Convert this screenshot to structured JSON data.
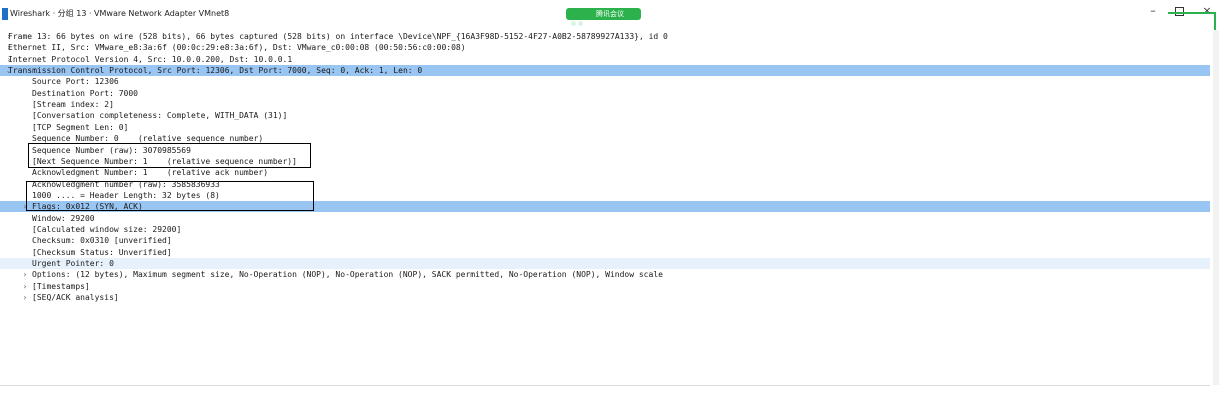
{
  "window": {
    "title": "Wireshark · 分组 13 · VMware Network Adapter VMnet8",
    "minimize": "–",
    "close": "×",
    "meeting_label": "腾讯会议"
  },
  "colors": {
    "selected": "#99c5f2",
    "hover": "#e7f1fb",
    "accent": "#2bb24c"
  },
  "tree": [
    {
      "caret": "›",
      "text": "Frame 13: 66 bytes on wire (528 bits), 66 bytes captured (528 bits) on interface \\Device\\NPF_{16A3F98D-5152-4F27-A0B2-58789927A133}, id 0"
    },
    {
      "caret": "›",
      "text": "Ethernet II, Src: VMware_e8:3a:6f (00:0c:29:e8:3a:6f), Dst: VMware_c0:00:08 (00:50:56:c0:00:08)"
    },
    {
      "caret": "›",
      "text": "Internet Protocol Version 4, Src: 10.0.0.200, Dst: 10.0.0.1"
    },
    {
      "caret": "⌄",
      "text": "Transmission Control Protocol, Src Port: 12306, Dst Port: 7000, Seq: 0, Ack: 1, Len: 0"
    },
    {
      "caret": "",
      "text": "Source Port: 12306"
    },
    {
      "caret": "",
      "text": "Destination Port: 7000"
    },
    {
      "caret": "",
      "text": "[Stream index: 2]"
    },
    {
      "caret": "",
      "text": "[Conversation completeness: Complete, WITH_DATA (31)]"
    },
    {
      "caret": "",
      "text": "[TCP Segment Len: 0]"
    },
    {
      "caret": "",
      "text": "Sequence Number: 0    (relative sequence number)"
    },
    {
      "caret": "",
      "text": "Sequence Number (raw): 3070985569"
    },
    {
      "caret": "",
      "text": "[Next Sequence Number: 1    (relative sequence number)]"
    },
    {
      "caret": "",
      "text": "Acknowledgment Number: 1    (relative ack number)"
    },
    {
      "caret": "",
      "text": "Acknowledgment number (raw): 3585836933"
    },
    {
      "caret": "",
      "text": "1000 .... = Header Length: 32 bytes (8)"
    },
    {
      "caret": "›",
      "text": "Flags: 0x012 (SYN, ACK)"
    },
    {
      "caret": "",
      "text": "Window: 29200"
    },
    {
      "caret": "",
      "text": "[Calculated window size: 29200]"
    },
    {
      "caret": "",
      "text": "Checksum: 0x0310 [unverified]"
    },
    {
      "caret": "",
      "text": "[Checksum Status: Unverified]"
    },
    {
      "caret": "",
      "text": "Urgent Pointer: 0"
    },
    {
      "caret": "›",
      "text": "Options: (12 bytes), Maximum segment size, No-Operation (NOP), No-Operation (NOP), SACK permitted, No-Operation (NOP), Window scale"
    },
    {
      "caret": "›",
      "text": "[Timestamps]"
    },
    {
      "caret": "›",
      "text": "[SEQ/ACK analysis]"
    }
  ]
}
